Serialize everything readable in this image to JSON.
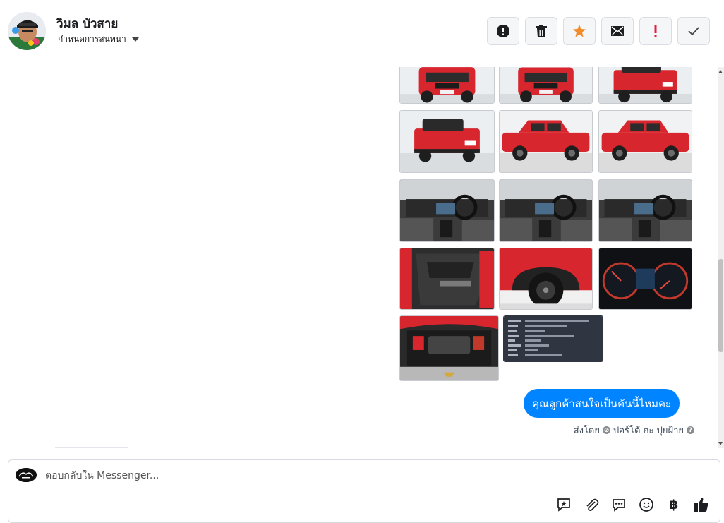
{
  "header": {
    "contact_name": "วิมล บัวสาย",
    "conversation_settings": "กำหนดการสนทนา",
    "actions": [
      {
        "name": "mark-spam-button",
        "icon": "alert-octagon-icon"
      },
      {
        "name": "delete-button",
        "icon": "trash-icon"
      },
      {
        "name": "star-button",
        "icon": "star-icon",
        "color": "#f28b2a"
      },
      {
        "name": "mark-unread-button",
        "icon": "envelope-icon"
      },
      {
        "name": "follow-up-button",
        "icon": "exclamation-icon",
        "color": "#e41e3f"
      },
      {
        "name": "done-button",
        "icon": "check-icon"
      }
    ]
  },
  "message": {
    "photos": [
      {
        "name": "truck-front-1",
        "kind": "truck-front"
      },
      {
        "name": "truck-front-2",
        "kind": "truck-front"
      },
      {
        "name": "truck-rear-1",
        "kind": "truck-rear"
      },
      {
        "name": "truck-rear-2",
        "kind": "truck-rear"
      },
      {
        "name": "truck-side-1",
        "kind": "truck-side"
      },
      {
        "name": "truck-side-2",
        "kind": "truck-side"
      },
      {
        "name": "interior-shifter",
        "kind": "interior"
      },
      {
        "name": "interior-dashboard",
        "kind": "interior"
      },
      {
        "name": "interior-console",
        "kind": "interior"
      },
      {
        "name": "door-panel",
        "kind": "door"
      },
      {
        "name": "front-wheel",
        "kind": "wheel"
      },
      {
        "name": "gauge-cluster",
        "kind": "gauges"
      },
      {
        "name": "engine-bay",
        "kind": "engine"
      },
      {
        "name": "spec-sheet",
        "kind": "document"
      }
    ],
    "bubble_text": "คุณลูกค้าสนใจเป็นคันนี้ไหมคะ",
    "sent_by_label": "ส่งโดย",
    "sender_name": "ปอร์โต้ กะ ปุยฝ้าย",
    "help_symbol": "?"
  },
  "composer": {
    "placeholder": "ตอบกลับใน Messenger...",
    "tools": [
      "saved-reply-icon",
      "attachment-icon",
      "comment-icon",
      "emoji-icon",
      "baht-icon",
      "thumbs-up-icon"
    ],
    "baht_symbol": "฿"
  },
  "colors": {
    "accent": "#0084ff",
    "car_red": "#d8262e",
    "star": "#f28b2a",
    "alert_red": "#e41e3f"
  }
}
